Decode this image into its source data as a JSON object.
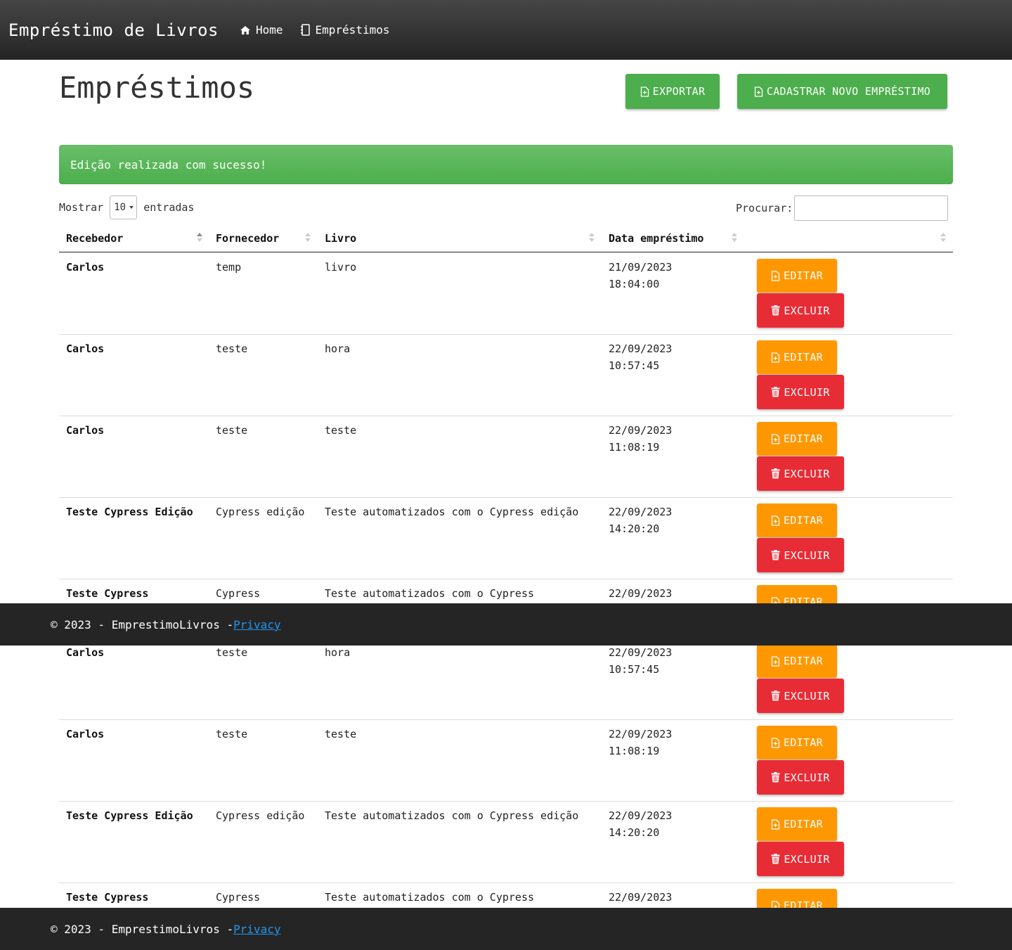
{
  "navbar": {
    "brand": "Empréstimo de Livros",
    "links": [
      {
        "label": "Home",
        "icon": "home-icon"
      },
      {
        "label": "Empréstimos",
        "icon": "notebook-icon"
      }
    ]
  },
  "page": {
    "title": "Empréstimos",
    "export_label": "EXPORTAR",
    "new_label": "CADASTRAR NOVO EMPRÉSTIMO"
  },
  "alert": {
    "message": "Edição realizada com sucesso!"
  },
  "table_controls": {
    "show_label": "Mostrar",
    "page_size": "10",
    "entries_label": "entradas",
    "search_label": "Procurar:",
    "search_value": ""
  },
  "table": {
    "columns": [
      "Recebedor",
      "Fornecedor",
      "Livro",
      "Data empréstimo",
      ""
    ],
    "edit_label": "EDITAR",
    "delete_label": "EXCLUIR"
  },
  "view1_rows": [
    {
      "recebedor": "Carlos",
      "fornecedor": "temp",
      "livro": "livro",
      "data": "21/09/2023",
      "hora": "18:04:00"
    },
    {
      "recebedor": "Carlos",
      "fornecedor": "teste",
      "livro": "hora",
      "data": "22/09/2023",
      "hora": "10:57:45"
    },
    {
      "recebedor": "Carlos",
      "fornecedor": "teste",
      "livro": "teste",
      "data": "22/09/2023",
      "hora": "11:08:19"
    },
    {
      "recebedor": "Teste Cypress Edição",
      "fornecedor": "Cypress edição",
      "livro": "Teste automatizados com o Cypress edição",
      "data": "22/09/2023",
      "hora": "14:20:20"
    },
    {
      "recebedor": "Teste Cypress",
      "fornecedor": "Cypress",
      "livro": "Teste automatizados com o Cypress",
      "data": "22/09/2023",
      "hora": ""
    }
  ],
  "view2_rows": [
    {
      "recebedor": "Carlos",
      "fornecedor": "teste",
      "livro": "hora",
      "data": "22/09/2023",
      "hora": "10:57:45"
    },
    {
      "recebedor": "Carlos",
      "fornecedor": "teste",
      "livro": "teste",
      "data": "22/09/2023",
      "hora": "11:08:19"
    },
    {
      "recebedor": "Teste Cypress Edição",
      "fornecedor": "Cypress edição",
      "livro": "Teste automatizados com o Cypress edição",
      "data": "22/09/2023",
      "hora": "14:20:20"
    },
    {
      "recebedor": "Teste Cypress",
      "fornecedor": "Cypress",
      "livro": "Teste automatizados com o Cypress",
      "data": "22/09/2023",
      "hora": ""
    }
  ],
  "footer": {
    "copyright": "© 2023 - EmprestimoLivros - ",
    "privacy_label": "Privacy"
  },
  "colors": {
    "navbar": "#2f2f2f",
    "success": "#4cae4c",
    "warning": "#ff9800",
    "danger": "#e82c36",
    "footer": "#252525",
    "link": "#2196f3"
  }
}
